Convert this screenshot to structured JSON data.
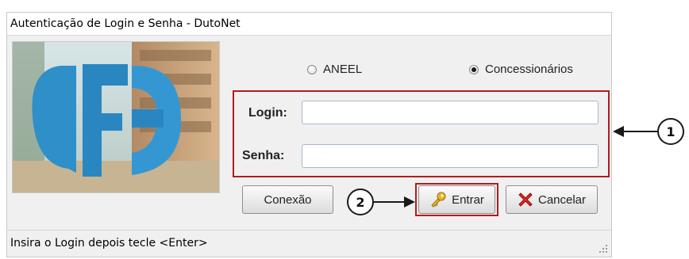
{
  "window": {
    "title": "Autenticação de Login e Senha - DutoNet",
    "status": "Insira o Login depois tecle <Enter>"
  },
  "radios": [
    {
      "label": "ANEEL",
      "checked": false
    },
    {
      "label": "Concessionários",
      "checked": true
    }
  ],
  "form": {
    "login_label": "Login:",
    "login_value": "",
    "senha_label": "Senha:",
    "senha_value": ""
  },
  "buttons": {
    "conexao": "Conexão",
    "entrar": "Entrar",
    "cancelar": "Cancelar"
  },
  "callouts": {
    "one": "1",
    "two": "2"
  },
  "icons": {
    "entrar": "key-icon",
    "cancelar": "red-x-icon"
  },
  "colors": {
    "highlight": "#b31b1b",
    "logo_blue": "#2f8fc8"
  }
}
